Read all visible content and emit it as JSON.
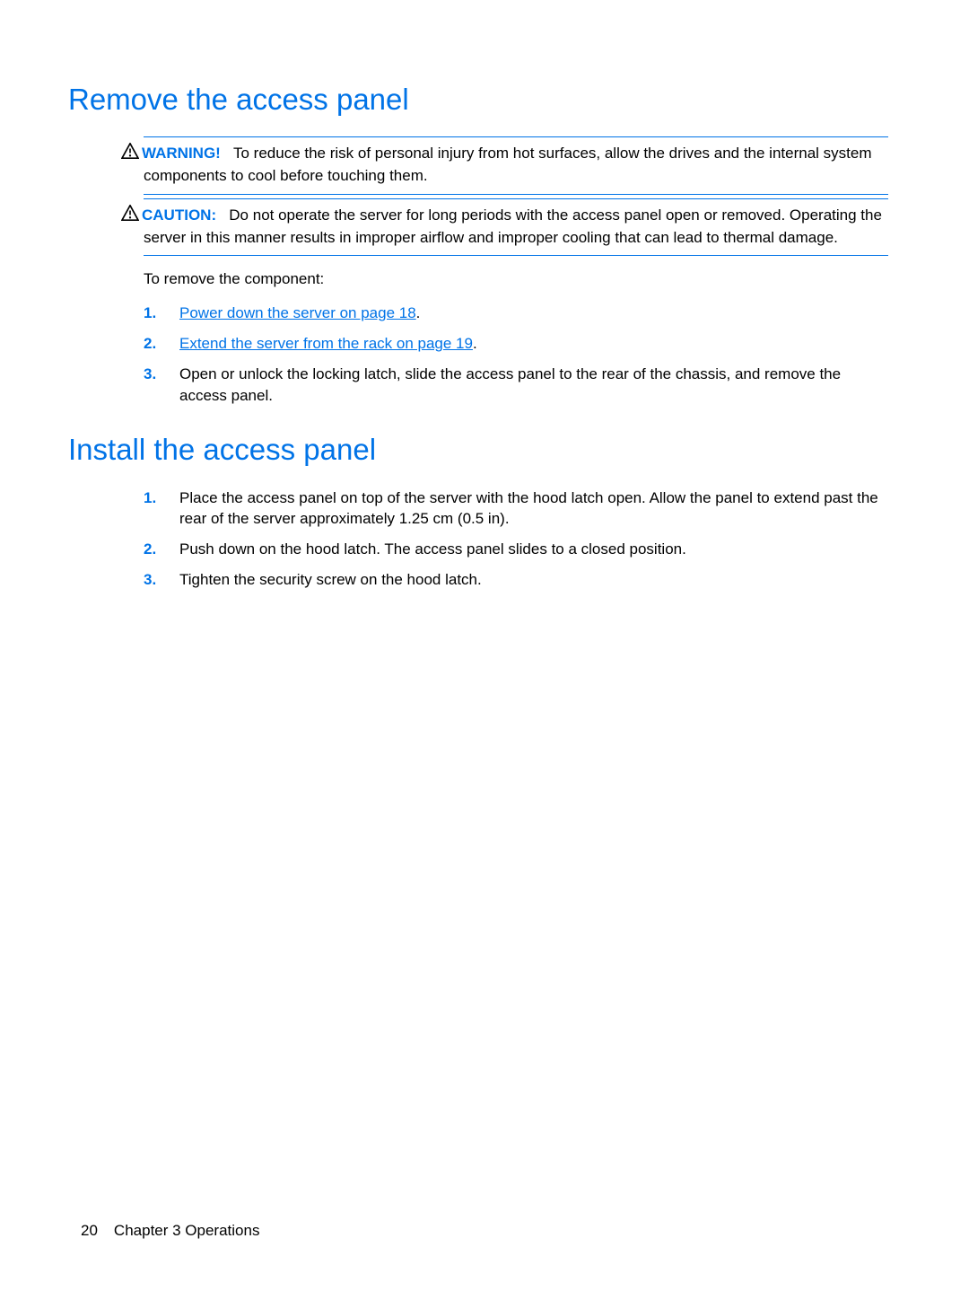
{
  "section1": {
    "heading": "Remove the access panel",
    "warning": {
      "label": "WARNING!",
      "text": "To reduce the risk of personal injury from hot surfaces, allow the drives and the internal system components to cool before touching them."
    },
    "caution": {
      "label": "CAUTION:",
      "text": "Do not operate the server for long periods with the access panel open or removed. Operating the server in this manner results in improper airflow and improper cooling that can lead to thermal damage."
    },
    "intro": "To remove the component:",
    "steps": [
      {
        "n": "1.",
        "link": "Power down the server on page 18",
        "suffix": "."
      },
      {
        "n": "2.",
        "link": "Extend the server from the rack on page 19",
        "suffix": "."
      },
      {
        "n": "3.",
        "text": "Open or unlock the locking latch, slide the access panel to the rear of the chassis, and remove the access panel."
      }
    ]
  },
  "section2": {
    "heading": "Install the access panel",
    "steps": [
      {
        "n": "1.",
        "text": "Place the access panel on top of the server with the hood latch open. Allow the panel to extend past the rear of the server approximately 1.25 cm (0.5 in)."
      },
      {
        "n": "2.",
        "text": "Push down on the hood latch. The access panel slides to a closed position."
      },
      {
        "n": "3.",
        "text": "Tighten the security screw on the hood latch."
      }
    ]
  },
  "footer": {
    "page": "20",
    "chapter": "Chapter 3   Operations"
  }
}
